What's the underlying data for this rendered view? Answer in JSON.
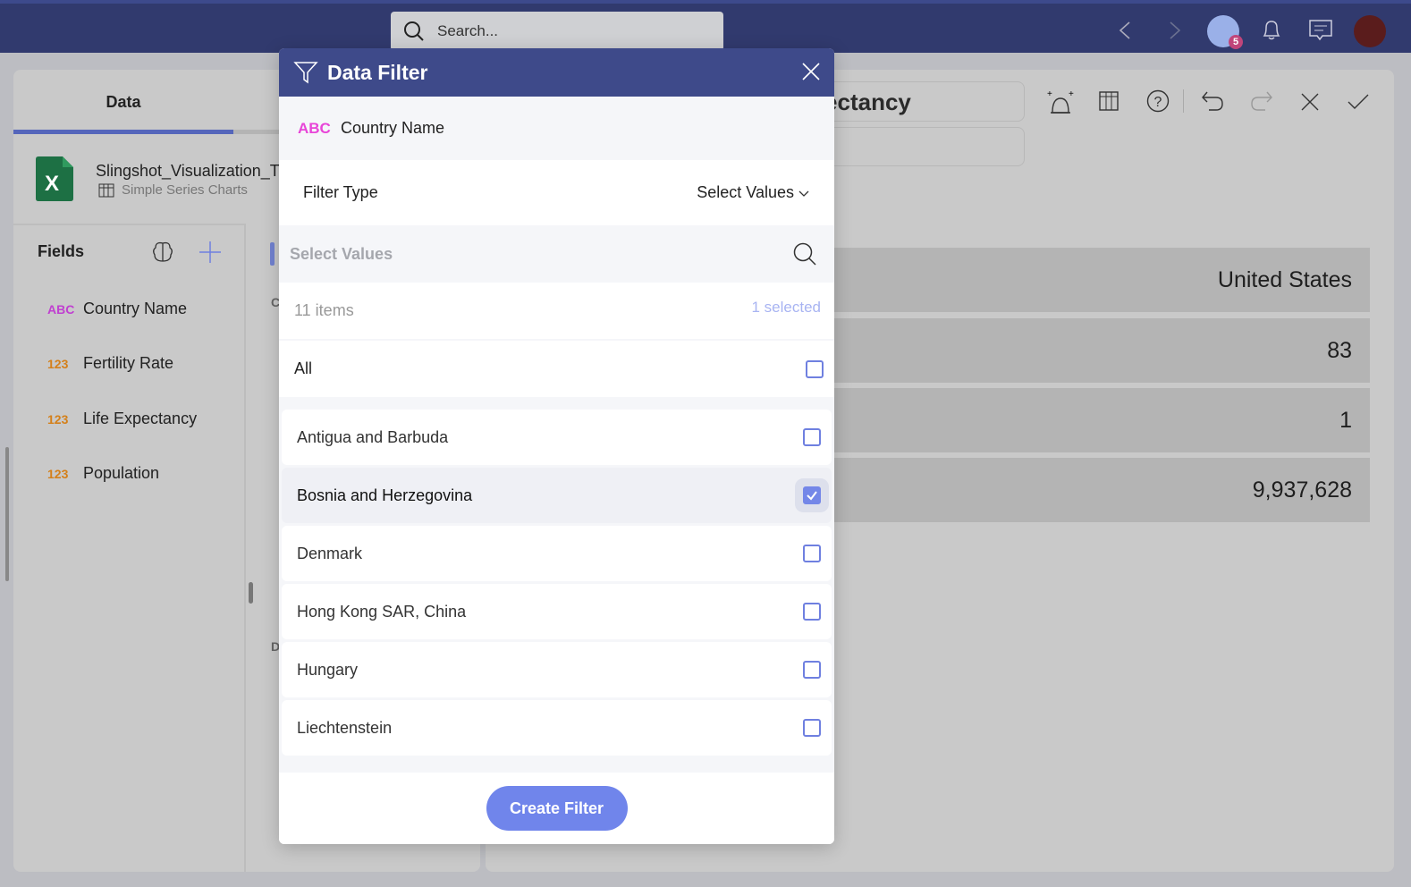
{
  "topbar": {
    "search_placeholder": "Search...",
    "badge_count": "5"
  },
  "left": {
    "tab": "Data",
    "file_name": "Slingshot_Visualization_Tu",
    "sheet_name": "Simple Series Charts",
    "fields_title": "Fields",
    "fields": [
      {
        "type": "ABC",
        "label": "Country Name"
      },
      {
        "type": "123",
        "label": "Fertility Rate"
      },
      {
        "type": "123",
        "label": "Life Expectancy"
      },
      {
        "type": "123",
        "label": "Population"
      }
    ],
    "clipped_labels": [
      "C",
      "D"
    ]
  },
  "right": {
    "title": "fe Expectancy",
    "rows": [
      "United States",
      "83",
      "1",
      "9,937,628"
    ]
  },
  "modal": {
    "title": "Data Filter",
    "field_type": "ABC",
    "field_name": "Country Name",
    "filter_type_label": "Filter Type",
    "filter_type_value": "Select Values",
    "search_placeholder": "Select Values",
    "count": "11 items",
    "selected": "1 selected",
    "all_label": "All",
    "items": [
      {
        "label": "Antigua and Barbuda",
        "checked": false
      },
      {
        "label": "Bosnia and Herzegovina",
        "checked": true
      },
      {
        "label": "Denmark",
        "checked": false
      },
      {
        "label": "Hong Kong SAR, China",
        "checked": false
      },
      {
        "label": "Hungary",
        "checked": false
      },
      {
        "label": "Liechtenstein",
        "checked": false
      }
    ],
    "create_label": "Create Filter"
  },
  "colors": {
    "header": "#313a6e",
    "modal_header": "#3e4a8a",
    "accent": "#7085eb",
    "abc": "#c040d0",
    "number": "#d4801a"
  }
}
